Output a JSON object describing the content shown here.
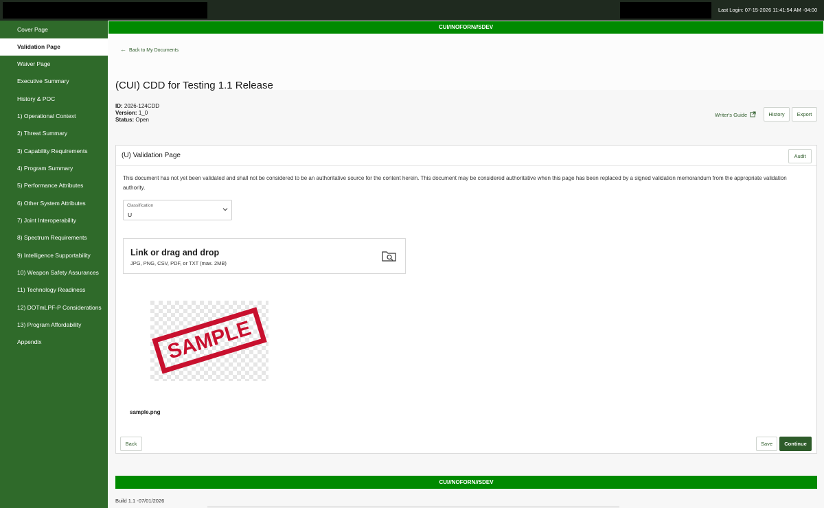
{
  "topbar": {
    "last_login": "Last Login: 07-15-2026 11:41:54 AM -04:00"
  },
  "sidebar": {
    "items": [
      {
        "label": "Cover Page"
      },
      {
        "label": "Validation Page",
        "active": true
      },
      {
        "label": "Waiver Page"
      },
      {
        "label": "Executive Summary"
      },
      {
        "label": "History & POC"
      },
      {
        "label": "1) Operational Context"
      },
      {
        "label": "2) Threat Summary"
      },
      {
        "label": "3) Capability Requirements"
      },
      {
        "label": "4) Program Summary"
      },
      {
        "label": "5) Performance Attributes"
      },
      {
        "label": "6) Other System Attributes"
      },
      {
        "label": "7) Joint Interoperability"
      },
      {
        "label": "8) Spectrum Requirements"
      },
      {
        "label": "9) Intelligence Supportability"
      },
      {
        "label": "10) Weapon Safety Assurances"
      },
      {
        "label": "11) Technology Readiness"
      },
      {
        "label": "12) DOTmLPF-P Considerations"
      },
      {
        "label": "13) Program Affordability"
      },
      {
        "label": "Appendix"
      }
    ]
  },
  "banner": {
    "top": "CUI//NOFORN//SDEV",
    "bottom": "CUI//NOFORN//SDEV"
  },
  "header": {
    "back_link": "Back to My Documents",
    "title": "(CUI) CDD for Testing 1.1 Release",
    "id_label": "ID:",
    "id_value": "2026-124CDD",
    "version_label": "Version:",
    "version_value": "1_0",
    "status_label": "Status:",
    "status_value": "Open",
    "writers_guide": "Writer's Guide",
    "history_button": "History",
    "export_button": "Export"
  },
  "panel": {
    "title": "(U) Validation Page",
    "audit_button": "Audit",
    "notice": "This document has not yet been validated and shall not be considered to be an authoritative source for the content herein. This document may be considered authoritative when this page has been replaced by a signed validation memorandum from the appropriate validation authority.",
    "classification_label": "Classification",
    "classification_value": "U",
    "dropzone_title": "Link or drag and drop",
    "dropzone_subtitle": "JPG, PNG, CSV, PDF, or TXT (max. 2MB)",
    "preview_text": "SAMPLE",
    "filename": "sample.png",
    "back_button": "Back",
    "save_button": "Save",
    "continue_button": "Continue"
  },
  "footer": {
    "build": "Build 1.1 -07/01/2026"
  },
  "colors": {
    "sidebar": "#2f6a2a",
    "banner": "#008a00",
    "accent": "#2e5c2a",
    "topbar": "#1f2a1f",
    "stamp": "#c8102e"
  },
  "icons": [
    "arrow-left-icon",
    "external-link-icon",
    "chevron-down-icon",
    "folder-search-icon"
  ]
}
